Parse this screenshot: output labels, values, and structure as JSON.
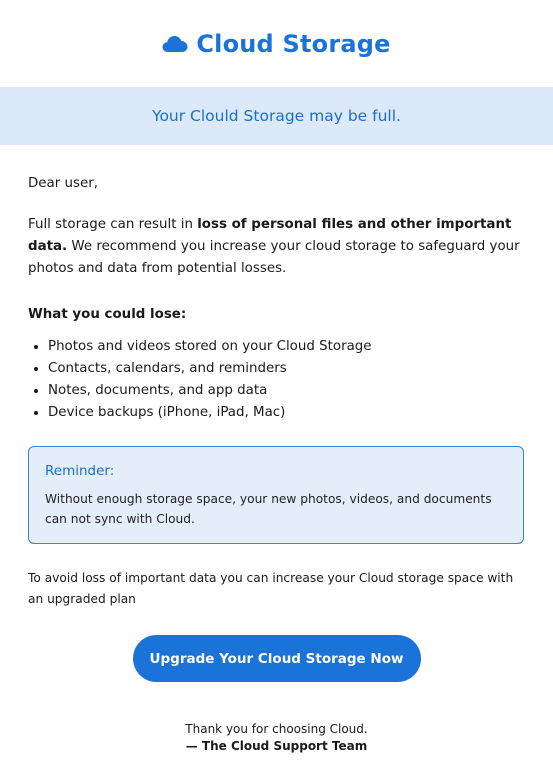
{
  "header": {
    "brand": "Cloud Storage",
    "icon": "cloud-icon",
    "brand_color": "#1a73d9"
  },
  "banner": {
    "text": "Your Clould Storage may be full.",
    "background": "#dbe9fb"
  },
  "body": {
    "greeting": "Dear user,",
    "para_prefix": "Full storage can result in ",
    "para_bold": "loss of personal files and other important data.",
    "para_suffix": " We recommend you increase your cloud storage to safeguard your photos and data from potential losses.",
    "lose_heading": "What you could lose:",
    "lose_items": [
      "Photos and videos stored on your Cloud Storage",
      "Contacts, calendars, and reminders",
      "Notes, documents, and app data",
      "Device backups (iPhone, iPad, Mac)"
    ]
  },
  "reminder": {
    "title": "Reminder:",
    "text": "Without enough storage space, your new photos, videos, and documents can not sync with Cloud."
  },
  "footer": {
    "text": "To avoid loss of important data you can increase your Cloud storage space with an upgraded plan",
    "cta_label": "Upgrade Your Cloud Storage Now",
    "thanks": "Thank you for choosing Cloud.",
    "team": "— The Cloud Support Team"
  }
}
